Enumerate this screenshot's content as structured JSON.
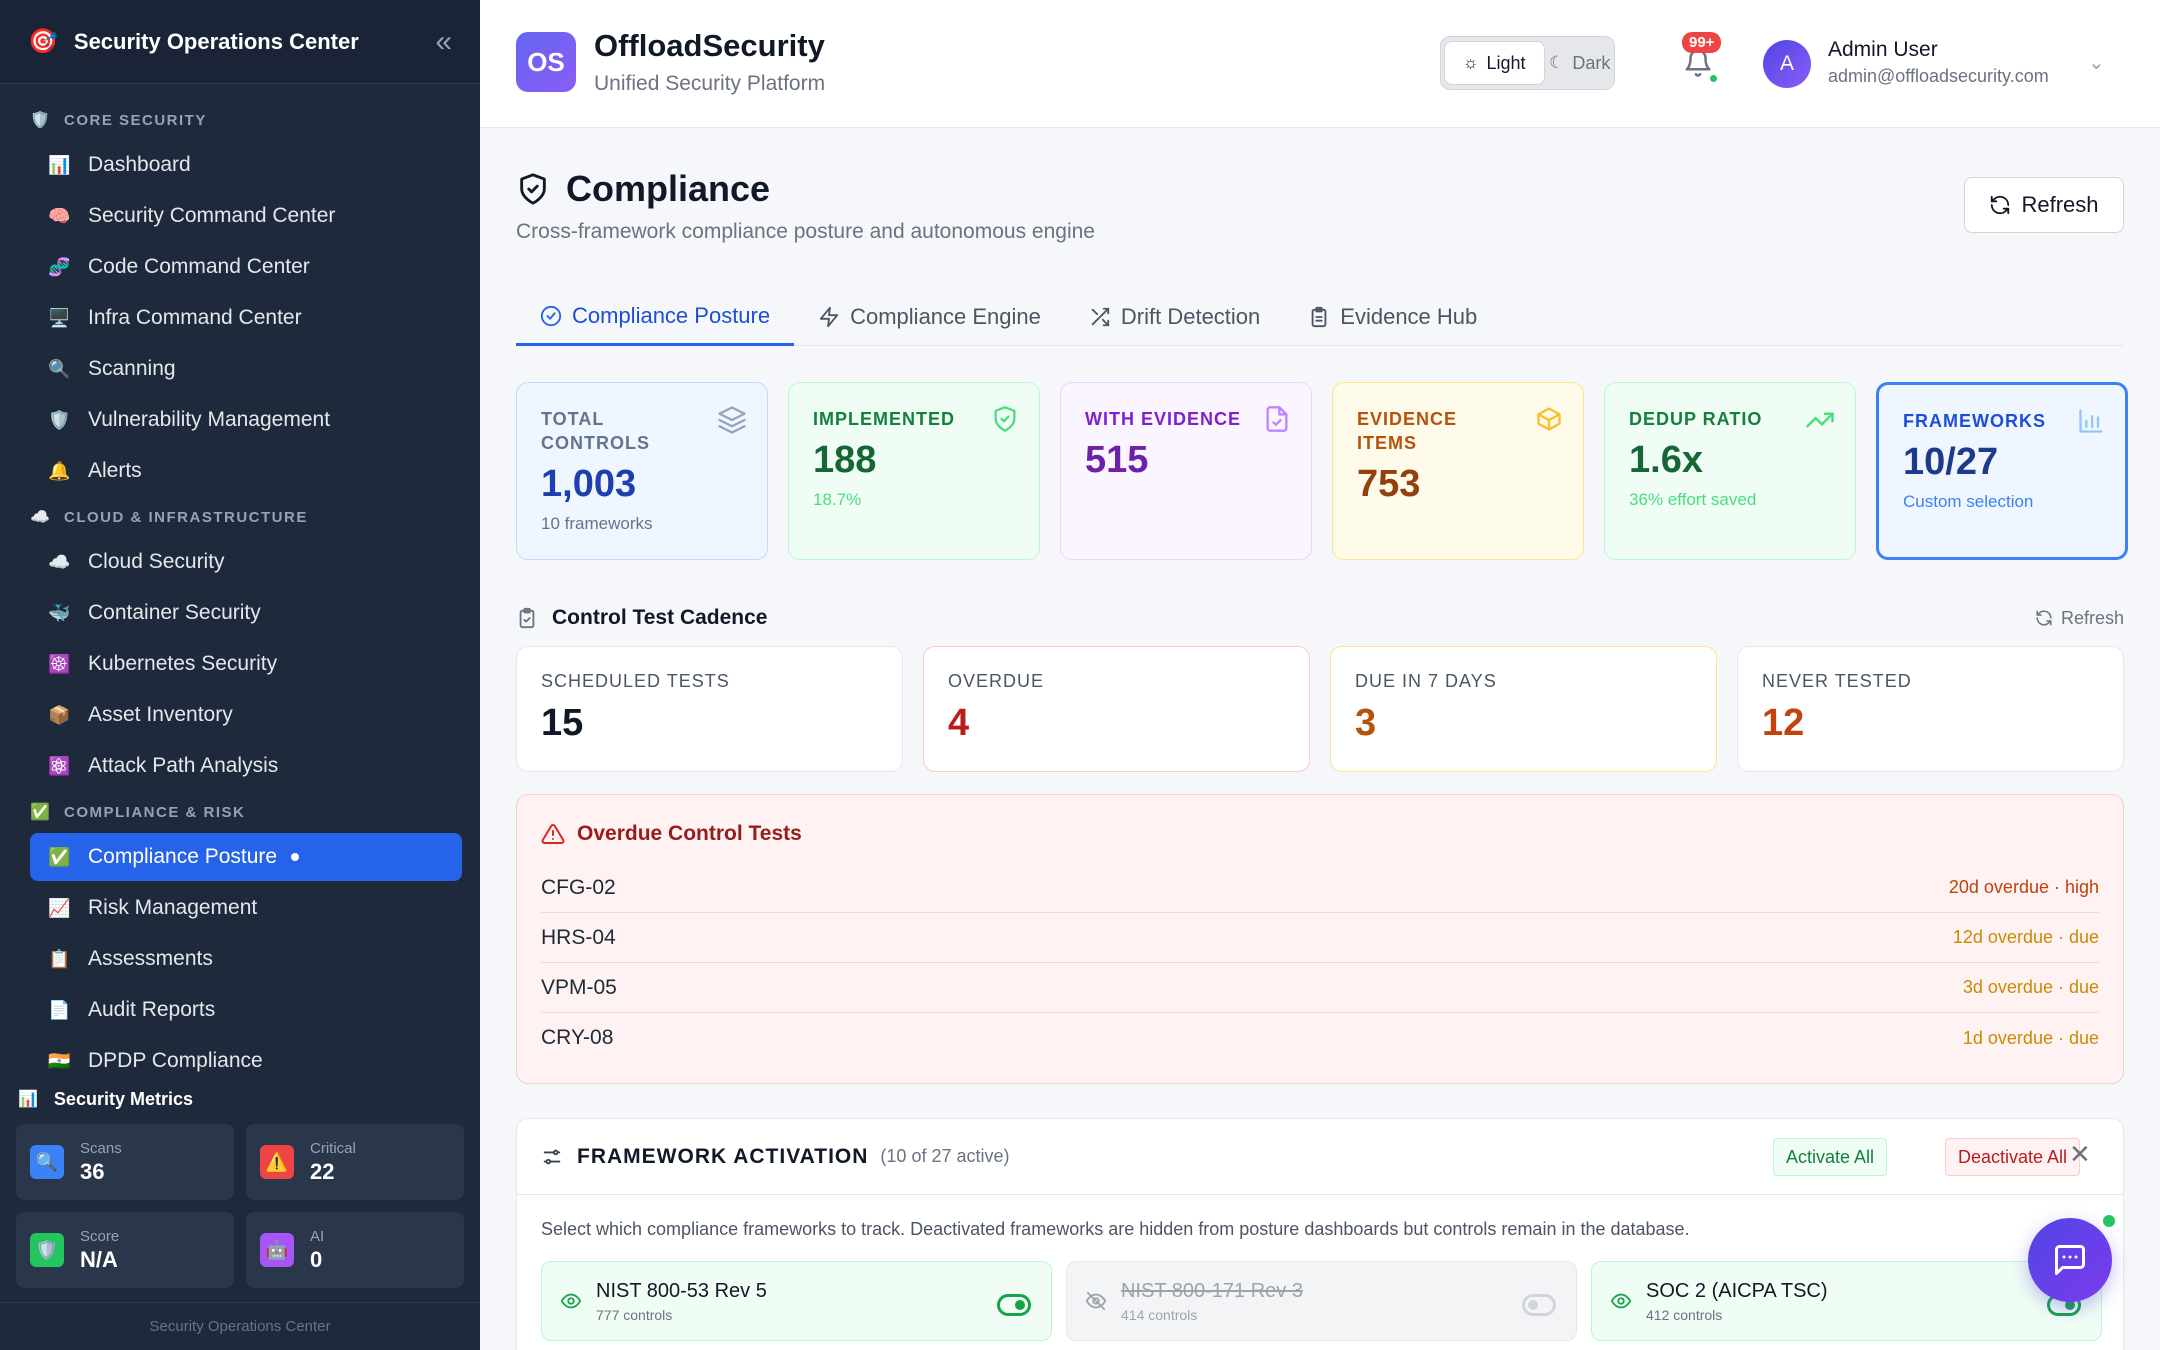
{
  "sidebar": {
    "title": "Security Operations Center",
    "sections": [
      {
        "label": "CORE SECURITY",
        "icon": "shield-icon",
        "items": [
          {
            "label": "Dashboard",
            "icon": "bar-chart-icon"
          },
          {
            "label": "Security Command Center",
            "icon": "brain-icon"
          },
          {
            "label": "Code Command Center",
            "icon": "dna-icon"
          },
          {
            "label": "Infra Command Center",
            "icon": "monitor-icon"
          },
          {
            "label": "Scanning",
            "icon": "magnifier-icon"
          },
          {
            "label": "Vulnerability Management",
            "icon": "shield-icon"
          },
          {
            "label": "Alerts",
            "icon": "bell-icon"
          }
        ]
      },
      {
        "label": "CLOUD & INFRASTRUCTURE",
        "icon": "cloud-icon",
        "items": [
          {
            "label": "Cloud Security",
            "icon": "cloud-icon"
          },
          {
            "label": "Container Security",
            "icon": "whale-icon"
          },
          {
            "label": "Kubernetes Security",
            "icon": "helm-icon"
          },
          {
            "label": "Asset Inventory",
            "icon": "package-icon"
          },
          {
            "label": "Attack Path Analysis",
            "icon": "atom-icon"
          }
        ]
      },
      {
        "label": "COMPLIANCE & RISK",
        "icon": "check-box-icon",
        "items": [
          {
            "label": "Compliance Posture",
            "icon": "check-box-icon",
            "active": true
          },
          {
            "label": "Risk Management",
            "icon": "trend-chart-icon"
          },
          {
            "label": "Assessments",
            "icon": "clipboard-icon"
          },
          {
            "label": "Audit Reports",
            "icon": "document-icon"
          },
          {
            "label": "DPDP Compliance",
            "icon": "india-flag-icon"
          }
        ]
      }
    ],
    "metrics_title": "Security Metrics",
    "metrics": [
      {
        "label": "Scans",
        "value": "36",
        "icon": "magnifier-icon",
        "color": "#3b82f6"
      },
      {
        "label": "Critical",
        "value": "22",
        "icon": "warning-icon",
        "color": "#ef4444"
      },
      {
        "label": "Score",
        "value": "N/A",
        "icon": "shield-icon",
        "color": "#22c55e"
      },
      {
        "label": "AI",
        "value": "0",
        "icon": "robot-icon",
        "color": "#a855f7"
      }
    ],
    "footer": "Security Operations Center"
  },
  "header": {
    "logo": "OS",
    "brand": "OffloadSecurity",
    "tagline": "Unified Security Platform",
    "theme_light": "Light",
    "theme_dark": "Dark",
    "notif_badge": "99+",
    "avatar_initial": "A",
    "user_name": "Admin User",
    "user_email": "admin@offloadsecurity.com"
  },
  "page": {
    "title": "Compliance",
    "subtitle": "Cross-framework compliance posture and autonomous engine",
    "refresh": "Refresh",
    "tabs": [
      "Compliance Posture",
      "Compliance Engine",
      "Drift Detection",
      "Evidence Hub"
    ]
  },
  "stats": [
    {
      "label": "TOTAL CONTROLS",
      "value": "1,003",
      "sub": "10 frameworks",
      "icon": "layers-icon"
    },
    {
      "label": "IMPLEMENTED",
      "value": "188",
      "sub": "18.7%",
      "icon": "shield-check-icon"
    },
    {
      "label": "WITH EVIDENCE",
      "value": "515",
      "sub": "",
      "icon": "file-check-icon"
    },
    {
      "label": "EVIDENCE ITEMS",
      "value": "753",
      "sub": "",
      "icon": "box-icon"
    },
    {
      "label": "DEDUP RATIO",
      "value": "1.6x",
      "sub": "36% effort saved",
      "icon": "trending-up-icon"
    },
    {
      "label": "FRAMEWORKS",
      "value": "10/27",
      "sub": "Custom selection",
      "icon": "bar-chart-icon"
    }
  ],
  "cadence": {
    "title": "Control Test Cadence",
    "refresh": "Refresh",
    "items": [
      {
        "label": "SCHEDULED TESTS",
        "value": "15"
      },
      {
        "label": "OVERDUE",
        "value": "4"
      },
      {
        "label": "DUE IN 7 DAYS",
        "value": "3"
      },
      {
        "label": "NEVER TESTED",
        "value": "12"
      }
    ]
  },
  "overdue": {
    "title": "Overdue Control Tests",
    "rows": [
      {
        "id": "CFG-02",
        "status": "20d overdue · high"
      },
      {
        "id": "HRS-04",
        "status": "12d overdue · due"
      },
      {
        "id": "VPM-05",
        "status": "3d overdue · due"
      },
      {
        "id": "CRY-08",
        "status": "1d overdue · due"
      }
    ]
  },
  "framework": {
    "title": "FRAMEWORK ACTIVATION",
    "count": "(10 of 27 active)",
    "activate": "Activate All",
    "deactivate": "Deactivate All",
    "description": "Select which compliance frameworks to track. Deactivated frameworks are hidden from posture dashboards but controls remain in the database.",
    "items": [
      {
        "name": "NIST 800-53 Rev 5",
        "controls": "777 controls",
        "active": true
      },
      {
        "name": "NIST 800-171 Rev 3",
        "controls": "414 controls",
        "active": false
      },
      {
        "name": "SOC 2 (AICPA TSC)",
        "controls": "412 controls",
        "active": true
      }
    ]
  }
}
